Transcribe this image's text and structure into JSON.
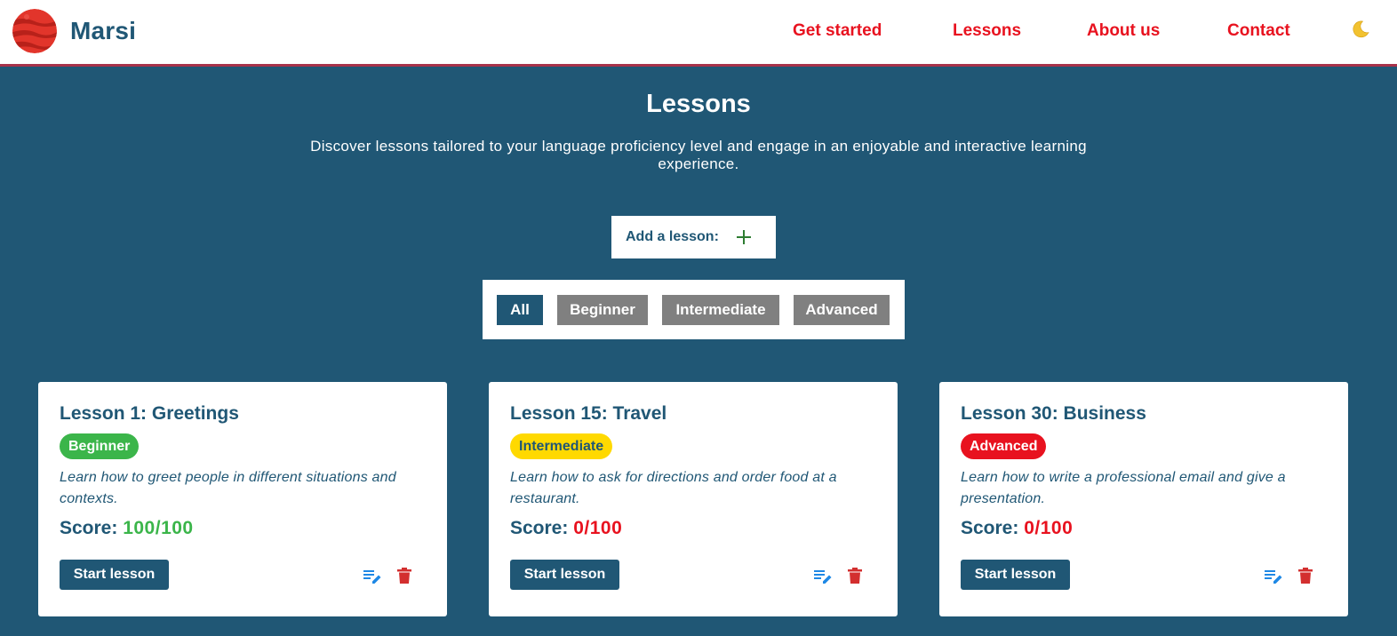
{
  "brand": {
    "name": "Marsi",
    "logo_icon": "mars-planet-icon"
  },
  "nav": {
    "items": [
      {
        "label": "Get started"
      },
      {
        "label": "Lessons"
      },
      {
        "label": "About us"
      },
      {
        "label": "Contact"
      }
    ],
    "theme_toggle_icon": "moon-icon"
  },
  "page": {
    "title": "Lessons",
    "intro": "Discover lessons tailored to your language proficiency level and engage in an enjoyable and interactive learning experience."
  },
  "add_lesson": {
    "label": "Add a lesson:",
    "icon": "plus-icon"
  },
  "filters": {
    "items": [
      {
        "label": "All",
        "active": true
      },
      {
        "label": "Beginner",
        "active": false
      },
      {
        "label": "Intermediate",
        "active": false
      },
      {
        "label": "Advanced",
        "active": false
      }
    ]
  },
  "colors": {
    "primary": "#205775",
    "nav_red": "#e8121f",
    "beginner": "#3bb54a",
    "intermediate": "#ffd900",
    "advanced": "#e8121f",
    "filter_inactive": "#808080"
  },
  "lessons": [
    {
      "title": "Lesson 1: Greetings",
      "level": "Beginner",
      "description": "Learn how to greet people in different situations and contexts.",
      "score_label": "Score:",
      "score": "100/100",
      "start_label": "Start lesson",
      "edit_icon": "edit-icon",
      "delete_icon": "trash-icon"
    },
    {
      "title": "Lesson 15: Travel",
      "level": "Intermediate",
      "description": "Learn how to ask for directions and order food at a restaurant.",
      "score_label": "Score:",
      "score": "0/100",
      "start_label": "Start lesson",
      "edit_icon": "edit-icon",
      "delete_icon": "trash-icon"
    },
    {
      "title": "Lesson 30: Business",
      "level": "Advanced",
      "description": "Learn how to write a professional email and give a presentation.",
      "score_label": "Score:",
      "score": "0/100",
      "start_label": "Start lesson",
      "edit_icon": "edit-icon",
      "delete_icon": "trash-icon"
    }
  ]
}
